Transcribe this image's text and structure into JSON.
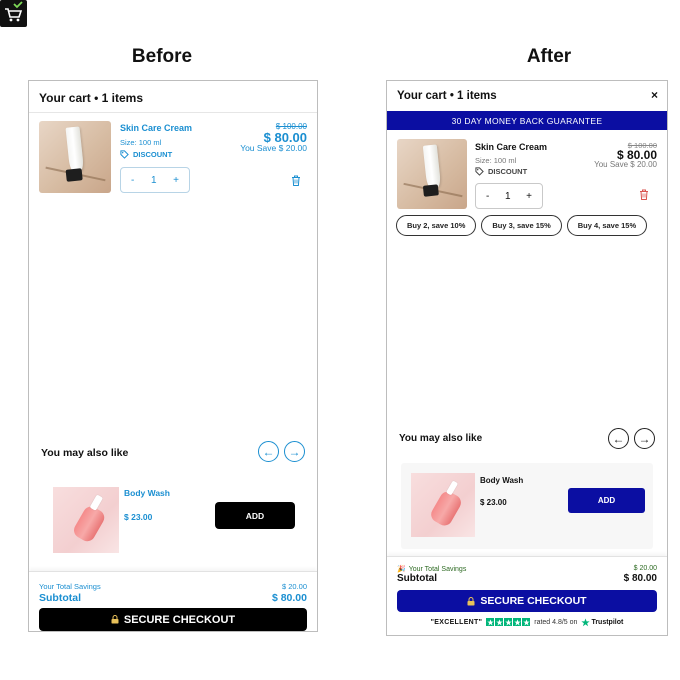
{
  "colors": {
    "before_accent": "#1b8fd1",
    "before_button": "#000000",
    "after_brand": "#0b0ea2",
    "after_savings": "#2d6a22",
    "trustpilot_green": "#00b67a",
    "trash_after": "#d9534f"
  },
  "headings": {
    "before": "Before",
    "after": "After"
  },
  "before": {
    "cart_title": "Your cart • 1 items",
    "item": {
      "name": "Skin Care Cream",
      "size": "Size: 100 ml",
      "discount_label": "DISCOUNT",
      "old_price": "$ 100.00",
      "price": "$ 80.00",
      "you_save": "You Save $ 20.00",
      "qty_minus": "-",
      "qty": "1",
      "qty_plus": "+",
      "image_icon": "skin-cream-tube-icon"
    },
    "recs": {
      "title": "You may also like",
      "arrow_left": "←",
      "arrow_right": "→",
      "item_name": "Body Wash",
      "item_price": "$ 23.00",
      "add_label": "ADD"
    },
    "footer": {
      "savings_label": "Your Total Savings",
      "savings_value": "$ 20.00",
      "subtotal_label": "Subtotal",
      "subtotal_value": "$ 80.00",
      "checkout_label": "SECURE CHECKOUT"
    }
  },
  "after": {
    "cart_title": "Your cart • 1 items",
    "close": "×",
    "banner": "30 DAY MONEY BACK GUARANTEE",
    "item": {
      "name": "Skin Care Cream",
      "size": "Size: 100 ml",
      "discount_label": "DISCOUNT",
      "old_price": "$ 100.00",
      "price": "$ 80.00",
      "you_save": "You Save $ 20.00",
      "qty_minus": "-",
      "qty": "1",
      "qty_plus": "+"
    },
    "tiers": [
      "Buy 2, save 10%",
      "Buy 3, save 15%",
      "Buy 4, save 15%"
    ],
    "recs": {
      "title": "You may also like",
      "arrow_left": "←",
      "arrow_right": "→",
      "item_name": "Body Wash",
      "item_price": "$ 23.00",
      "add_label": "ADD"
    },
    "footer": {
      "savings_emoji": "🎉",
      "savings_label": "Your Total Savings",
      "savings_value": "$ 20.00",
      "subtotal_label": "Subtotal",
      "subtotal_value": "$ 80.00",
      "checkout_label": "SECURE CHECKOUT",
      "trust_excellent": "\"EXCELLENT\"",
      "trust_rating": "rated 4.8/5 on",
      "trust_brand": "Trustpilot",
      "trust_stars": 5
    }
  }
}
